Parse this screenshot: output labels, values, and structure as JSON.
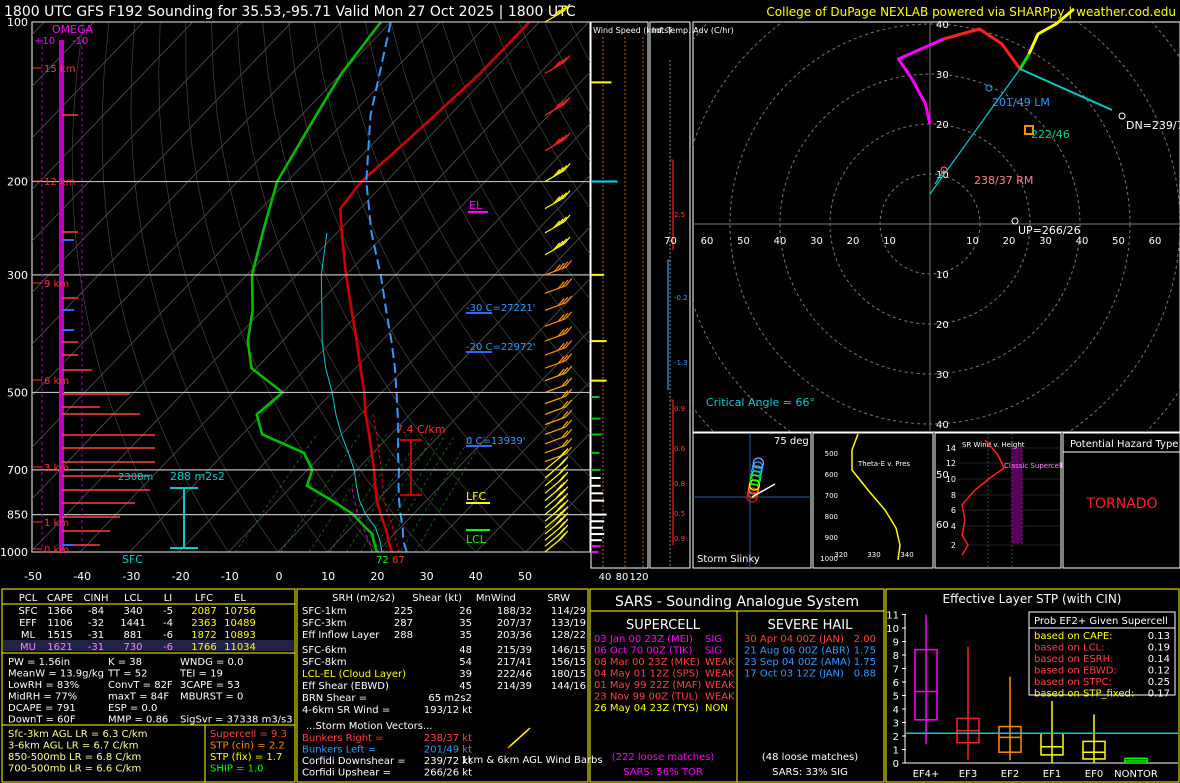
{
  "header": {
    "title": "1800 UTC GFS F192 Sounding for 35.53,-95.71 Valid  Mon 27 Oct 2025 | 1800 UTC",
    "credit": "College of DuPage NEXLAB powered via SHARPpy | weather.cod.edu"
  },
  "colors": {
    "bg": "#000000",
    "temp": "#cc0000",
    "dewpoint": "#00bb00",
    "wetbulb": "#00cccc",
    "virtual": "#e00000",
    "parcel": "#3399ff",
    "hodo": "#ff2020",
    "yellow": "#ffff00",
    "magenta": "#ff00ff",
    "cyan": "#00cccc"
  },
  "chart_data": [
    {
      "type": "line",
      "name": "skew-t",
      "yaxis_pressure_labels": [
        "100",
        "200",
        "300",
        "500",
        "700",
        "850",
        "1000"
      ],
      "xaxis_temp_labels": [
        "-50",
        "-40",
        "-30",
        "-20",
        "-10",
        "0",
        "10",
        "20",
        "30",
        "40",
        "50"
      ],
      "height_labels": [
        "15 km",
        "12 km",
        "9 km",
        "6 km",
        "3 km",
        "1 km",
        "0 km"
      ],
      "omega_labels": {
        "title": "OMEGA",
        "left": "+10",
        "right": "-10"
      },
      "annotations": {
        "el": "EL",
        "lfc": "LFC",
        "lcl": "LCL",
        "m30": "-30 C=27221'",
        "m20": "-20 C=22972'",
        "zero": "0 C=13939'",
        "lapse": "7.4 C/km",
        "srh": "288 m2s2",
        "srh_depth": "2308m",
        "sfc": "SFC",
        "sfc_t": "67",
        "sfc_td": "72"
      },
      "series": [
        {
          "name": "temperature",
          "pressure": [
            1000,
            975,
            950,
            925,
            900,
            850,
            800,
            750,
            700,
            650,
            600,
            550,
            500,
            450,
            400,
            350,
            300,
            250,
            225,
            200,
            175,
            150,
            125,
            100
          ],
          "t": [
            23,
            21.5,
            20,
            18.6,
            17,
            13.5,
            10,
            6.8,
            3.5,
            -0.3,
            -4.4,
            -9,
            -13.5,
            -19,
            -25,
            -32,
            -40,
            -49,
            -54,
            -55,
            -54,
            -53,
            -52,
            -52
          ]
        },
        {
          "name": "dewpoint",
          "pressure": [
            1000,
            975,
            950,
            925,
            900,
            850,
            800,
            750,
            700,
            650,
            600,
            550,
            500,
            450,
            400,
            350,
            300,
            250,
            200,
            150,
            125,
            100
          ],
          "td": [
            20,
            18.5,
            17,
            15.6,
            13,
            8,
            1,
            -7,
            -9,
            -14,
            -26,
            -31,
            -30,
            -41,
            -47,
            -52,
            -59,
            -65,
            -72,
            -77,
            -80,
            -82
          ]
        },
        {
          "name": "parcel",
          "pressure": [
            1000,
            950,
            900,
            850,
            800,
            750,
            700,
            650,
            600,
            550,
            500,
            450,
            400,
            350,
            300,
            250,
            200,
            150,
            100
          ],
          "t": [
            26,
            23,
            20.5,
            17.5,
            14.5,
            11.5,
            8.5,
            5,
            1.5,
            -2.5,
            -7,
            -12,
            -18,
            -25,
            -33,
            -43,
            -54,
            -66,
            -80
          ]
        }
      ]
    },
    {
      "type": "bar",
      "name": "wind-speed",
      "title": "Wind Speed (knots)",
      "xlabels": [
        "40",
        "80",
        "120"
      ],
      "pressure": [
        130,
        200,
        300,
        400,
        475,
        510,
        560,
        600,
        650,
        700,
        725,
        750,
        775,
        800,
        850,
        875,
        900,
        925,
        950,
        975,
        1000
      ],
      "values": [
        34,
        44,
        22,
        26,
        26,
        14,
        16,
        18,
        14,
        16,
        16,
        16,
        20,
        22,
        26,
        22,
        20,
        22,
        18,
        16,
        12
      ]
    },
    {
      "type": "line",
      "name": "inferred-temp-advection",
      "title": "Inf. Temp. Adv (C/hr)",
      "labels": [
        "2.5",
        "-0.2",
        "-1.3",
        "0.9",
        "0.6",
        "0.8",
        "0.5",
        "0.9"
      ]
    },
    {
      "type": "line",
      "name": "hodograph",
      "rings": [
        "10",
        "20",
        "30",
        "40",
        "50",
        "60"
      ],
      "axis_labels": [
        "70",
        "60",
        "50",
        "40",
        "30",
        "20",
        "10",
        "10",
        "20",
        "30",
        "40",
        "50",
        "60",
        "70"
      ],
      "u": [
        0,
        -1,
        -4,
        -7,
        3,
        11,
        16,
        20,
        22,
        24,
        28,
        32
      ],
      "v": [
        20,
        24,
        29,
        33,
        37,
        39,
        36,
        31,
        34,
        38,
        40,
        43
      ],
      "labels": {
        "lm": "201/49 LM",
        "rm": "238/37 RM",
        "mean": "222/46",
        "dn": "DN=239/72",
        "up": "UP=266/26",
        "critical": "Critical Angle = 66°"
      }
    }
  ],
  "insets": {
    "slinky": {
      "title": "Storm Slinky",
      "angle": "75 deg"
    },
    "theta": {
      "title": "Theta-E v. Pres",
      "ylabels": [
        "500",
        "600",
        "700",
        "800",
        "900",
        "1000"
      ],
      "xlabels": [
        "320",
        "330",
        "340"
      ]
    },
    "srwind": {
      "title": "SR Wind v. Height",
      "ylabels": [
        "14",
        "12",
        "10",
        "8",
        "6",
        "4",
        "2"
      ],
      "note": "Classic Supercell"
    },
    "hazard": {
      "title": "Potential Hazard Type",
      "value": "TORNADO"
    }
  },
  "thermo_table": {
    "headers": [
      "PCL",
      "CAPE",
      "CINH",
      "LCL",
      "LI",
      "LFC",
      "EL"
    ],
    "rows": [
      [
        "SFC",
        "1366",
        "-84",
        "340",
        "-5",
        "2087",
        "10756"
      ],
      [
        "EFF",
        "1106",
        "-32",
        "1441",
        "-4",
        "2363",
        "10489"
      ],
      [
        "ML",
        "1515",
        "-31",
        "881",
        "-6",
        "1872",
        "10893"
      ],
      [
        "MU",
        "1621",
        "-31",
        "730",
        "-6",
        "1766",
        "11034"
      ]
    ],
    "params": [
      [
        "PW = 1.56in",
        "K = 38",
        "WNDG = 0.0"
      ],
      [
        "MeanW = 13.9g/kg",
        "TT = 52",
        "TEI = 19"
      ],
      [
        "LowRH = 83%",
        "ConvT = 82F",
        "3CAPE = 53"
      ],
      [
        "MidRH = 77%",
        "maxT = 84F",
        "MBURST = 0"
      ],
      [
        "DCAPE = 791",
        "ESP = 0.0",
        ""
      ],
      [
        "DownT = 60F",
        "MMP = 0.86",
        "SigSvr = 37338 m3/s3"
      ]
    ],
    "lapse": [
      "Sfc-3km AGL LR = 6.3 C/km",
      "3-6km AGL LR = 6.7 C/km",
      "850-500mb LR = 6.8 C/km",
      "700-500mb LR = 6.6 C/km"
    ],
    "composites": [
      "Supercell = 9.3",
      "STP (cin) = 2.2",
      "STP (fix) = 1.7",
      "SHIP = 1.0"
    ]
  },
  "kinematic_table": {
    "headers": [
      "SRH (m2/s2)",
      "Shear (kt)",
      "MnWind",
      "SRW"
    ],
    "rows": [
      [
        "SFC-1km",
        "225",
        "26",
        "188/32",
        "114/29"
      ],
      [
        "SFC-3km",
        "287",
        "35",
        "207/37",
        "133/19"
      ],
      [
        "Eff Inflow Layer",
        "288",
        "35",
        "203/36",
        "128/22"
      ],
      [
        "SFC-6km",
        "",
        "48",
        "215/39",
        "146/15"
      ],
      [
        "SFC-8km",
        "",
        "54",
        "217/41",
        "156/15"
      ],
      [
        "LCL-EL (Cloud Layer)",
        "",
        "39",
        "222/46",
        "180/15"
      ],
      [
        "Eff Shear (EBWD)",
        "",
        "45",
        "214/39",
        "144/16"
      ]
    ],
    "brn": [
      "BRN Shear =",
      "65 m2s2"
    ],
    "srw": [
      "4-6km SR Wind =",
      "193/12 kt"
    ],
    "motion_title": "...Storm Motion Vectors...",
    "motion": [
      [
        "Bunkers Right =",
        "238/37 kt"
      ],
      [
        "Bunkers Left =",
        "201/49 kt"
      ],
      [
        "Corfidi Downshear =",
        "239/72 kt"
      ],
      [
        "Corfidi Upshear =",
        "266/26 kt"
      ]
    ],
    "barbs_label": "1km & 6km AGL Wind Barbs"
  },
  "sars": {
    "title": "SARS - Sounding Analogue System",
    "supercell": {
      "title": "SUPERCELL",
      "rows": [
        [
          "03 Jan 00 23Z (MEI)",
          "SIG"
        ],
        [
          "06 Oct 70 00Z (TIK)",
          "SIG"
        ],
        [
          "08 Mar 00 23Z (MKE)",
          "WEAK"
        ],
        [
          "04 May 01 12Z (SPS)",
          "WEAK"
        ],
        [
          "01 May 99 22Z (MAF)",
          "WEAK"
        ],
        [
          "23 Nov 99 00Z (TUL)",
          "WEAK"
        ],
        [
          "26 May 04 23Z (TYS)",
          "NON"
        ]
      ],
      "matches": "(222 loose matches)",
      "prob": "SARS: 56% TOR"
    },
    "hail": {
      "title": "SEVERE HAIL",
      "rows": [
        [
          "30 Apr 04 00Z (JAN)",
          "2.00"
        ],
        [
          "21 Aug 06 00Z (ABR)",
          "1.75"
        ],
        [
          "23 Sep 04 00Z (AMA)",
          "1.75"
        ],
        [
          "17 Oct 03 12Z (JAN)",
          "0.88"
        ]
      ],
      "matches": "(48 loose matches)",
      "prob": "SARS: 33% SIG"
    }
  },
  "stp_box": {
    "title": "Effective Layer STP (with CIN)",
    "ylabels": [
      "11",
      "10",
      "9",
      "8",
      "7",
      "6",
      "5",
      "4",
      "3",
      "2",
      "1",
      "0"
    ],
    "categories": [
      "EF4+",
      "EF3",
      "EF2",
      "EF1",
      "EF0",
      "NONTOR"
    ],
    "box_q1": [
      3.2,
      1.5,
      0.8,
      0.6,
      0.3,
      0.0
    ],
    "box_med": [
      5.3,
      2.4,
      1.9,
      1.2,
      0.8,
      0.15
    ],
    "box_q3": [
      8.4,
      3.3,
      2.7,
      2.2,
      1.6,
      0.35
    ],
    "whisker_lo": [
      1.4,
      0.2,
      0.2,
      0.0,
      0.0,
      0.0
    ],
    "whisker_hi": [
      11.0,
      8.6,
      6.4,
      4.6,
      3.6,
      0.0
    ],
    "stp_value": 2.2,
    "prob_title": "Prob EF2+ Given Supercell",
    "prob_rows": [
      [
        "based on CAPE:",
        "0.13"
      ],
      [
        "based on LCL:",
        "0.19"
      ],
      [
        "based on ESRH:",
        "0.14"
      ],
      [
        "based on EBWD:",
        "0.12"
      ],
      [
        "based on STPC:",
        "0.25"
      ],
      [
        "based on STP_fixed:",
        "0.17"
      ]
    ]
  }
}
